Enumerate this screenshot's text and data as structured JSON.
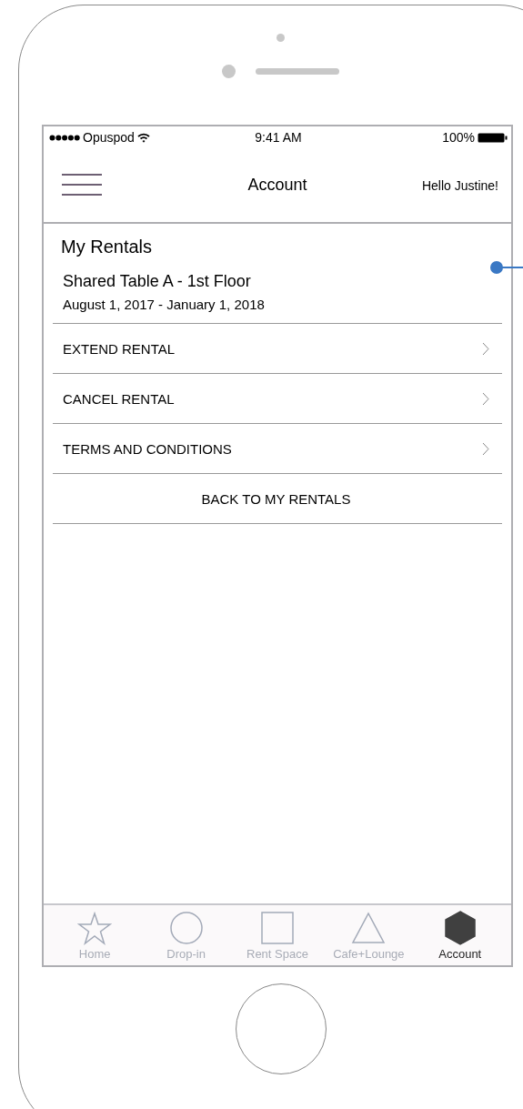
{
  "status_bar": {
    "carrier": "Opuspod",
    "time": "9:41 AM",
    "battery": "100%"
  },
  "nav_bar": {
    "title": "Account",
    "greeting": "Hello Justine!"
  },
  "section": {
    "title": "My Rentals",
    "rental_name": "Shared Table A - 1st Floor",
    "rental_dates": "August 1, 2017 - January 1, 2018"
  },
  "menu_items": [
    {
      "label": "EXTEND RENTAL",
      "kind": "chevron"
    },
    {
      "label": "CANCEL RENTAL",
      "kind": "chevron"
    },
    {
      "label": "TERMS AND CONDITIONS",
      "kind": "chevron"
    },
    {
      "label": "BACK TO MY RENTALS",
      "kind": "centered"
    }
  ],
  "tab_bar": [
    {
      "label": "Home",
      "kind": "star",
      "selected": false
    },
    {
      "label": "Drop-in",
      "kind": "circle",
      "selected": false
    },
    {
      "label": "Rent Space",
      "kind": "square",
      "selected": false
    },
    {
      "label": "Cafe+Lounge",
      "kind": "triangle",
      "selected": false
    },
    {
      "label": "Account",
      "kind": "hexagon",
      "selected": true
    }
  ]
}
